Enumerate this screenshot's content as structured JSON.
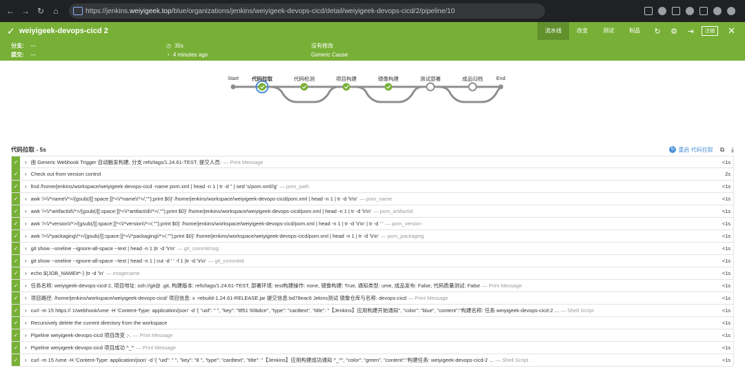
{
  "browser": {
    "url_prefix": "https://jenkins.",
    "url_domain": "weiyigeek.top",
    "url_path": "/blue/organizations/jenkins/weiyigeek-devops-cicd/detail/weiyigeek-devops-cicd/2/pipeline/10"
  },
  "run": {
    "title": "weiyigeek-devops-cicd  2",
    "tabs": [
      "流水线",
      "改变",
      "测试",
      "制品"
    ],
    "logout": "注销",
    "branch_label": "分支:",
    "branch_value": "—",
    "commit_label": "提交:",
    "commit_value": "—",
    "duration": "35s",
    "started": "4 minutes ago",
    "changes": "没有修改",
    "cause": "Generic Cause",
    "status_color": "#78b037"
  },
  "stages": [
    "Start",
    "代码拉取",
    "代码检测",
    "项目构建",
    "镜像构建",
    "测试部署",
    "成品归档",
    "End"
  ],
  "logs": {
    "title": "代码拉取 - 5s",
    "restart": "重启 代码拉取",
    "steps": [
      {
        "text": "由 Generic Webhook Trigger 自动触发构建, 分支 refs/tags/1.24.61-TEST, 提交人员:",
        "type": "— Print Message",
        "dur": "<1s"
      },
      {
        "text": "Check out from version control",
        "type": "",
        "dur": "2s"
      },
      {
        "text": "find /home/jenkins/workspace/weiyigeek-devops-cicd -name pom.xml | head -n 1 | tr -d '' | sed 's/pom.xml//g'",
        "type": "— pom_path",
        "dur": "<1s"
      },
      {
        "text": "awk '/<\\/*name\\/*>/{gsub(/[[:space:]]*<\\/*name\\/*>/,\"\");print $0}' /home/jenkins/workspace/weiyigeek-devops-cicd/pom.xml | head -n 1 | tr -d '\\r\\n'",
        "type": "— pom_name",
        "dur": "<1s"
      },
      {
        "text": "awk '/<\\/*artifactId\\/*>/{gsub(/[[:space:]]*<\\/*artifactId\\/*>/,\"\");print $0}' /home/jenkins/workspace/weiyigeek-devops-cicd/pom.xml | head -n 1 | tr -d '\\r\\n'",
        "type": "— pom_artifactId",
        "dur": "<1s"
      },
      {
        "text": "awk '/<\\/*version\\/*>/{gsub(/[[:space:]]*<\\/*version\\/*>/,\"\");print $0}' /home/jenkins/workspace/weiyigeek-devops-cicd/pom.xml | head -n 1 | tr -d '\\r\\n' | tr -d ' '",
        "type": "— pom_version",
        "dur": "<1s"
      },
      {
        "text": "awk '/<\\/*packaging\\/*>/{gsub(/[[:space:]]*<\\/*packaging\\/*>/,\"\");print $0}' /home/jenkins/workspace/weiyigeek-devops-cicd/pom.xml | head -n 1 | tr -d '\\r\\n'",
        "type": "— pom_packaging",
        "dur": "<1s"
      },
      {
        "text": "git show --oneline --ignore-all-space --text | head -n 1 |tr -d '\\r\\n'",
        "type": "— git_commitmsg",
        "dur": "<1s"
      },
      {
        "text": "git show --oneline --ignore-all-space --text | head -n 1 | cut -d ' ' -f 1 |tr -d '\\r\\n'",
        "type": "— git_commitid",
        "dur": "<1s"
      },
      {
        "text": "echo ${JOB_NAME#*-} |tr -d '\\n'",
        "type": "— imagename",
        "dur": "<1s"
      },
      {
        "text": "任务名称: weiyigeek-devops-cicd-2, 项目地址: ssh://git@ .git, 构建版本: refs/tags/1.24.61-TEST, 部署环境: test构建操作: none, 镜像构建: True, 通知类型: ume, 成品发布: False, 代码质量测试: False",
        "type": "— Print Message",
        "dur": "<1s"
      },
      {
        "text": "项目路径: /home/jenkins/workspace/weiyigeek-devops-cicd/ 项目信息: x -rebuild-1.24.61-RELEASE.jar 提交信息:bd78eac6 Jekins测试 镜像仓库与名称: devops-cicd",
        "type": "— Print Message",
        "dur": "<1s"
      },
      {
        "text": "curl -m 15 https:// 1/webhook/ume -H 'Content-Type: application/json' -d '{ \"uid\": \" \", \"key\": \"8f51 50bdce\", \"type\": \"cardtext\", \"title\": \"【Jenkins】应用构建开始通知\", \"color\": \"blue\", \"content\":\"构建名称: 任务 weiyigeek-devops-cicd-2 ...",
        "type": "— Shell Script",
        "dur": "<1s"
      },
      {
        "text": "Recursively delete the current directory from the workspace",
        "type": "",
        "dur": "<1s"
      },
      {
        "text": "Pipeline weiyigeek-devops-cicd 项目改变 ;-.",
        "type": "— Print Message",
        "dur": "<1s"
      },
      {
        "text": "Pipeline weiyigeek-devops-cicd 项目成功 ^_^",
        "type": "— Print Message",
        "dur": "<1s"
      },
      {
        "text": "curl -m 15 /ume -H 'Content-Type: application/json' -d '{ \"uid\": \" \", \"key\": \"8 \", \"type\": \"cardtext\", \"title\": \"【Jenkins】应用构建成功通知 ^_^\", \"color\": \"green\", \"content\":\"构建任务: weiyigeek-devops-cicd-2 ...",
        "type": "— Shell Script",
        "dur": "<1s"
      }
    ]
  }
}
